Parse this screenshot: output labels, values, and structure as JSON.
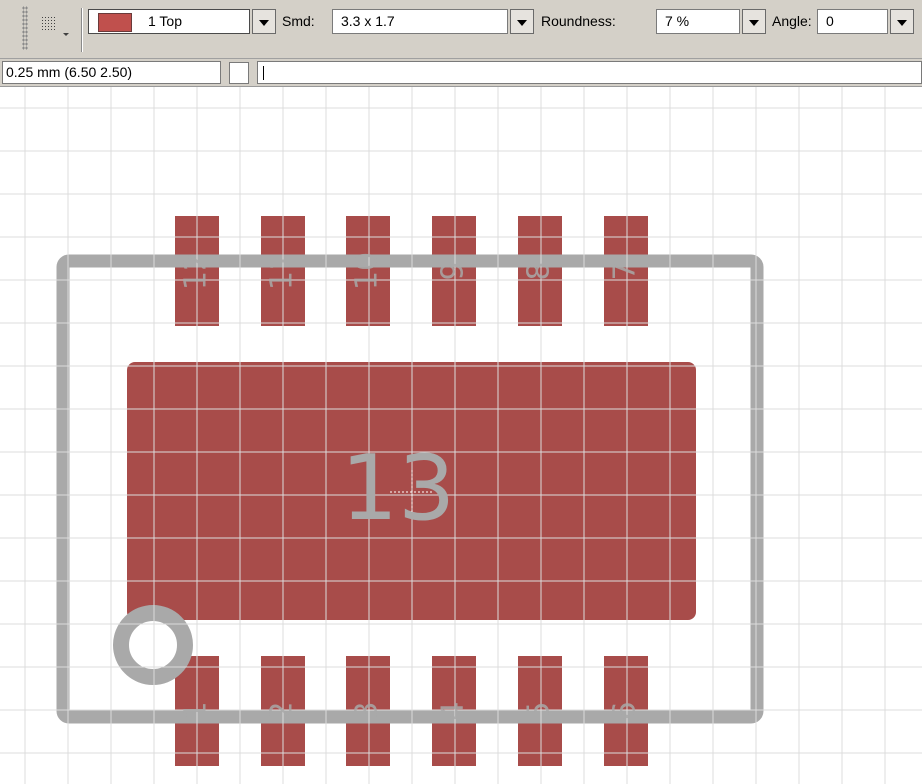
{
  "toolbar": {
    "grid_icon": "grid-icon",
    "layer": {
      "swatch_color": "#c0504d",
      "label": "1 Top"
    },
    "smd": {
      "label": "Smd:",
      "value": "3.3 x 1.7"
    },
    "roundness": {
      "label": "Roundness:",
      "value": "7 %"
    },
    "angle": {
      "label": "Angle:",
      "value": "0"
    }
  },
  "status": {
    "coordinates": "0.25 mm (6.50 2.50)",
    "command": ""
  },
  "canvas": {
    "pad_color": "#a84c4a",
    "outline_color": "#a9a9a9",
    "grid_color": "#dcdcdc",
    "center_pad_label": "13",
    "top_pad_labels": [
      "12",
      "11",
      "10",
      "9",
      "8",
      "7"
    ],
    "bottom_pad_labels": [
      "1",
      "2",
      "3",
      "4",
      "5",
      "6"
    ]
  }
}
